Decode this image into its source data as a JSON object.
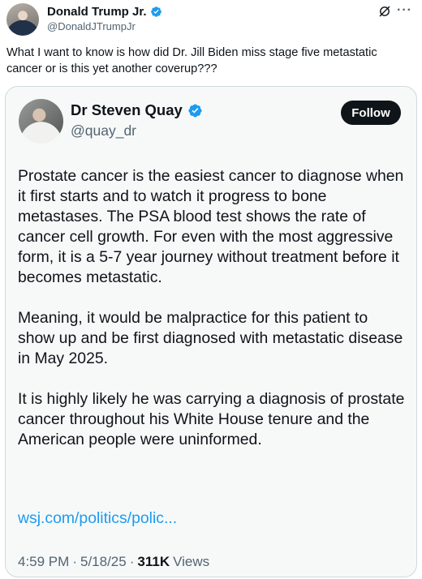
{
  "outer_post": {
    "author_name": "Donald Trump Jr.",
    "author_handle": "@DonaldJTrumpJr",
    "text": "What I want to know is how did Dr. Jill Biden miss stage five metastatic cancer or is this yet another coverup???",
    "more_label": "···"
  },
  "quoted_post": {
    "author_name": "Dr Steven Quay",
    "author_handle": "@quay_dr",
    "follow_label": "Follow",
    "paragraphs": [
      "Prostate cancer is the easiest cancer to diagnose when it first starts and to watch it progress to bone metastases. The PSA blood test shows the rate of cancer cell growth. For even with the most aggressive form, it is a 5-7 year journey without treatment before it becomes metastatic.",
      "Meaning, it would be malpractice for this patient to show up and be first diagnosed with metastatic disease in May 2025.",
      "It is highly likely he was carrying a diagnosis of prostate cancer throughout his White House tenure and the American people were uninformed."
    ],
    "link_text": "wsj.com/politics/polic...",
    "time": "4:59 PM",
    "date": "5/18/25",
    "views_count": "311K",
    "views_label": "Views",
    "separator": "·"
  },
  "colors": {
    "verified_blue": "#1d9bf0",
    "link_blue": "#1d9bf0",
    "text_primary": "#0f1419",
    "text_secondary": "#536471"
  },
  "icons": [
    "verified-badge-icon",
    "grok-icon",
    "more-icon"
  ]
}
